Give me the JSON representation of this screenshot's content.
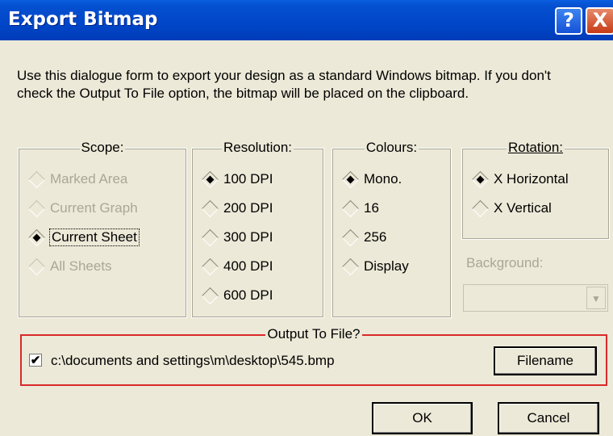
{
  "window": {
    "title": "Export Bitmap",
    "help_label": "?",
    "close_label": "X"
  },
  "description": "Use this dialogue form to export your design as a standard Windows bitmap. If you don't\ncheck the Output To File option, the bitmap will be placed on the clipboard.",
  "scope": {
    "legend": "Scope:",
    "options": [
      {
        "label": "Marked Area",
        "selected": false,
        "enabled": false
      },
      {
        "label": "Current Graph",
        "selected": false,
        "enabled": false
      },
      {
        "label": "Current Sheet",
        "selected": true,
        "enabled": true
      },
      {
        "label": "All Sheets",
        "selected": false,
        "enabled": false
      }
    ]
  },
  "resolution": {
    "legend": "Resolution:",
    "options": [
      {
        "label": "100 DPI",
        "selected": true
      },
      {
        "label": "200 DPI",
        "selected": false
      },
      {
        "label": "300 DPI",
        "selected": false
      },
      {
        "label": "400 DPI",
        "selected": false
      },
      {
        "label": "600 DPI",
        "selected": false
      }
    ]
  },
  "colours": {
    "legend": "Colours:",
    "options": [
      {
        "label": "Mono.",
        "selected": true
      },
      {
        "label": "16",
        "selected": false
      },
      {
        "label": "256",
        "selected": false
      },
      {
        "label": "Display",
        "selected": false
      }
    ]
  },
  "rotation": {
    "legend": "Rotation:",
    "options": [
      {
        "label": "X Horizontal",
        "selected": true
      },
      {
        "label": "X Vertical",
        "selected": false
      }
    ]
  },
  "background": {
    "label": "Background:",
    "value": ""
  },
  "output": {
    "legend": "Output To File?",
    "checked": true,
    "path": "c:\\documents and settings\\m\\desktop\\545.bmp",
    "filename_button": "Filename"
  },
  "buttons": {
    "ok": "OK",
    "cancel": "Cancel"
  },
  "colors": {
    "titlebar": "#0046c8",
    "dialog_bg": "#ece9d8",
    "disabled_text": "#a9a796",
    "highlight_border": "#d82a2a"
  }
}
